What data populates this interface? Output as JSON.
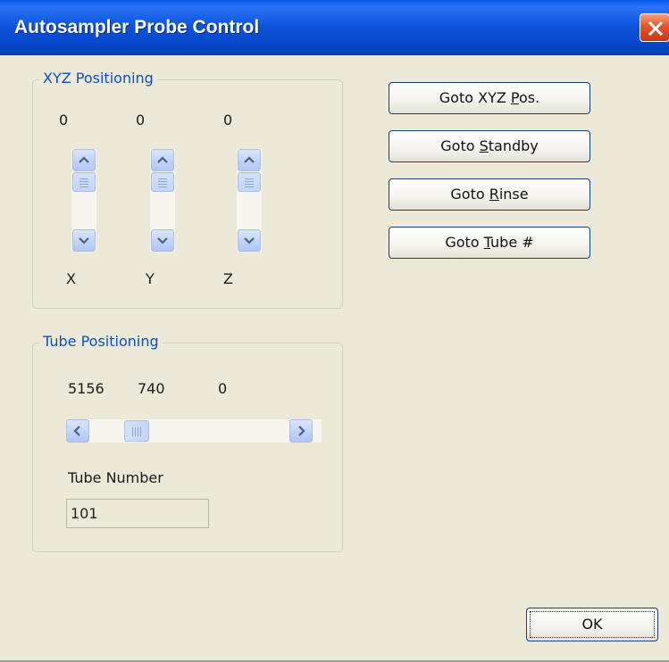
{
  "window": {
    "title": "Autosampler Probe Control"
  },
  "xyz": {
    "legend": "XYZ Positioning",
    "values": [
      "0",
      "0",
      "0"
    ],
    "axes": [
      "X",
      "Y",
      "Z"
    ]
  },
  "tube": {
    "legend": "Tube Positioning",
    "values": [
      "5156",
      "740",
      "0"
    ],
    "number_label": "Tube Number",
    "number_value": "101"
  },
  "actions": {
    "goto_xyz": {
      "before": "Goto XYZ ",
      "mnemonic": "P",
      "after": "os."
    },
    "goto_standby": {
      "before": "Goto ",
      "mnemonic": "S",
      "after": "tandby"
    },
    "goto_rinse": {
      "before": "Goto ",
      "mnemonic": "R",
      "after": "inse"
    },
    "goto_tube": {
      "before": "Goto ",
      "mnemonic": "T",
      "after": "ube #"
    }
  },
  "ok_label": "OK",
  "icons": {
    "close": "close-icon",
    "up": "chevron-up-icon",
    "down": "chevron-down-icon",
    "left": "chevron-left-icon",
    "right": "chevron-right-icon"
  },
  "colors": {
    "titlebar": "#0b52d8",
    "face": "#ece9d8",
    "legend_text": "#0b50c8",
    "close": "#e2552a"
  }
}
